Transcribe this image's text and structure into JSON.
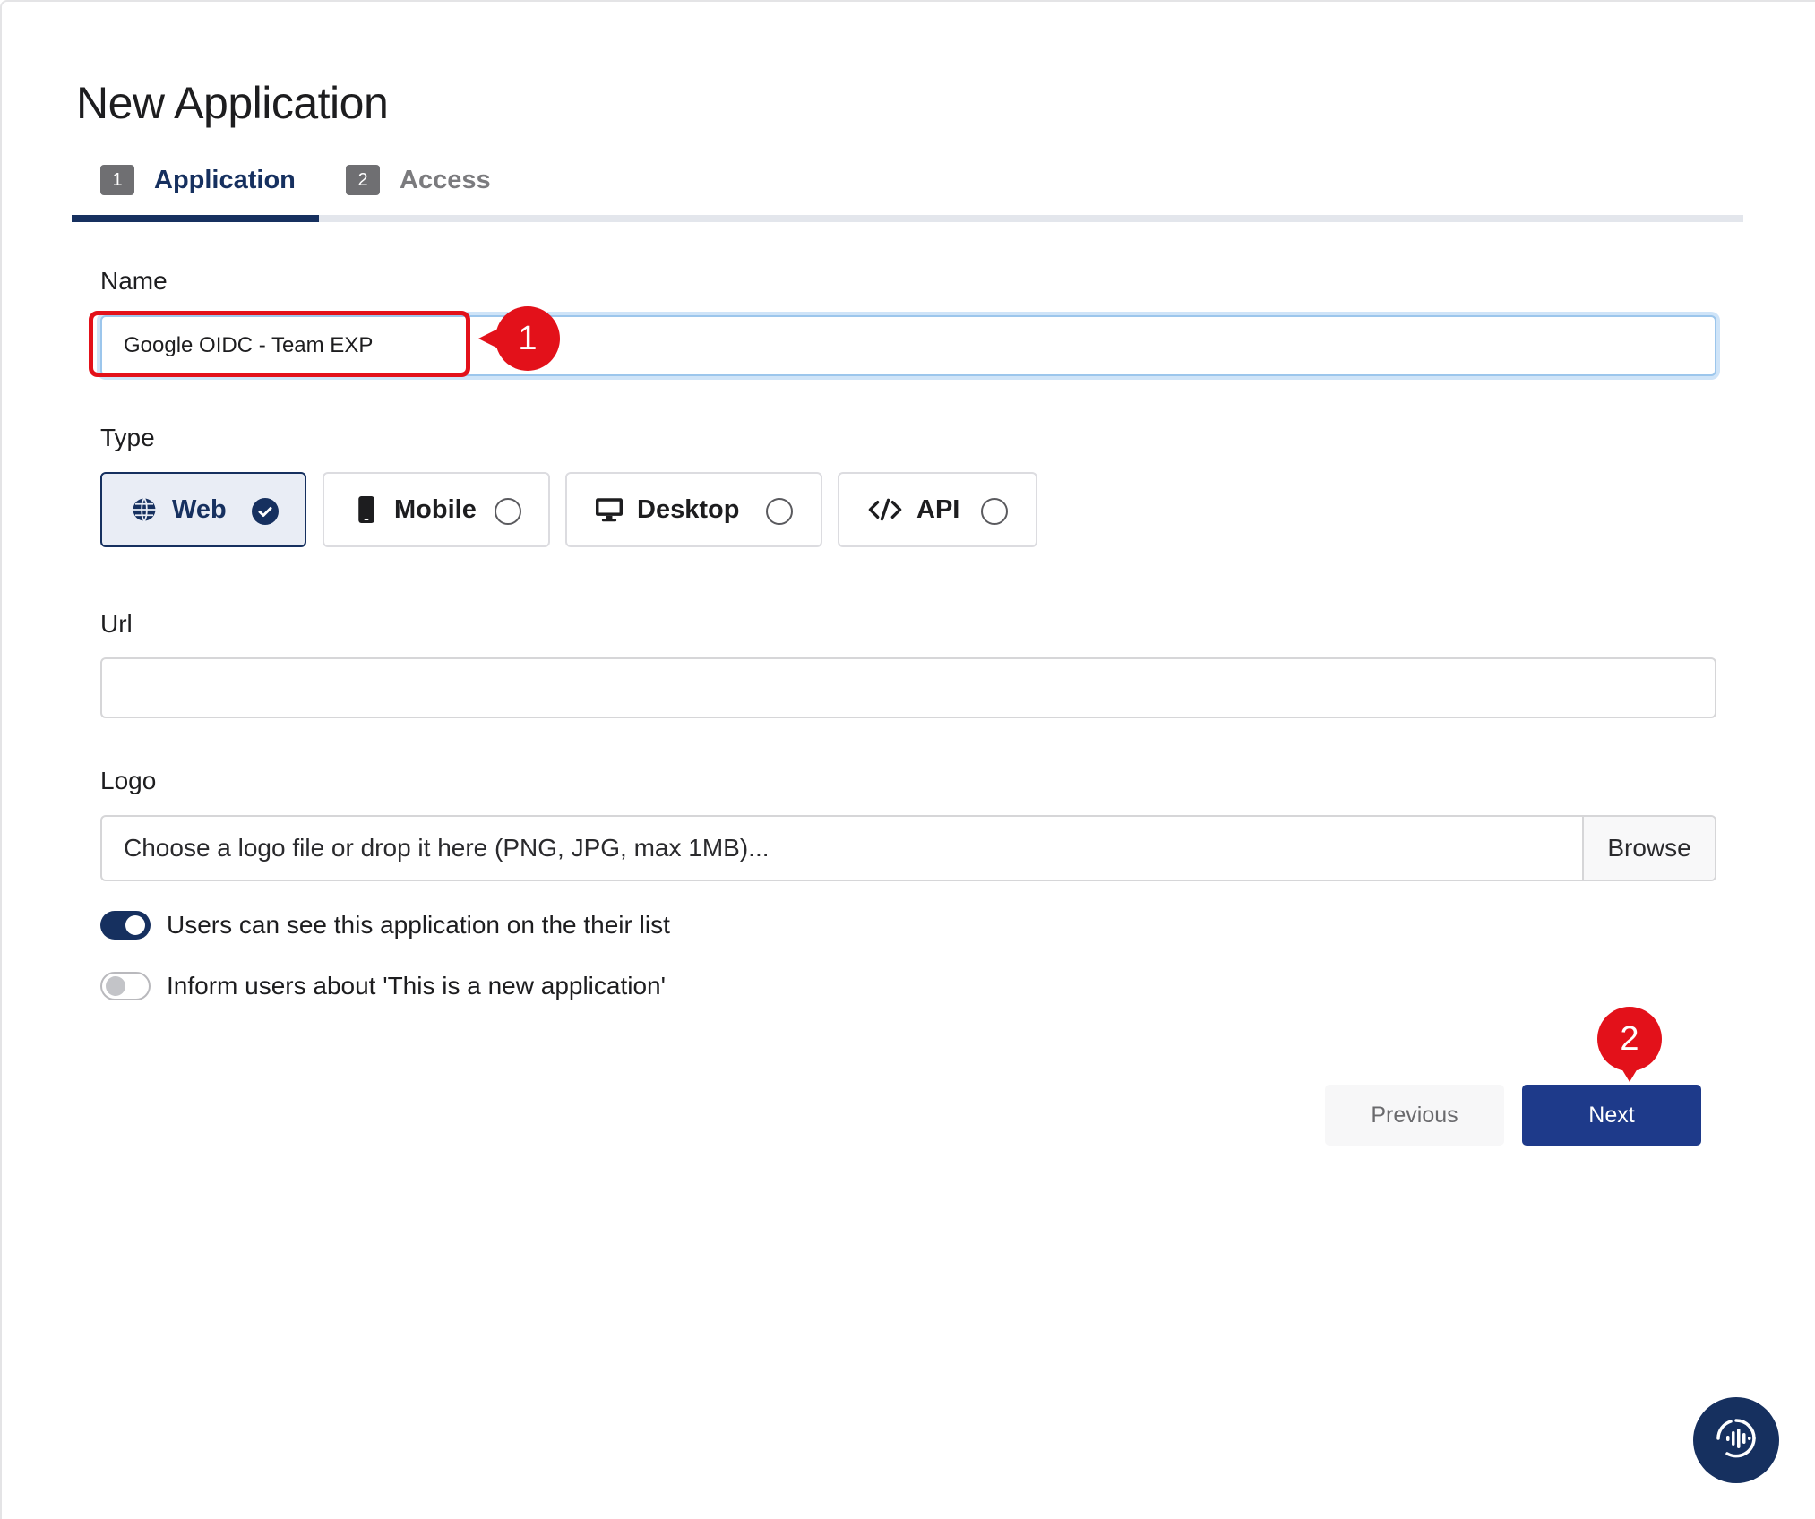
{
  "page": {
    "title": "New Application"
  },
  "tabs": [
    {
      "number": "1",
      "label": "Application",
      "active": true
    },
    {
      "number": "2",
      "label": "Access",
      "active": false
    }
  ],
  "form": {
    "name": {
      "label": "Name",
      "value": "Google OIDC - Team EXP"
    },
    "type": {
      "label": "Type",
      "options": [
        {
          "label": "Web",
          "icon": "globe-icon",
          "selected": true
        },
        {
          "label": "Mobile",
          "icon": "mobile-icon",
          "selected": false
        },
        {
          "label": "Desktop",
          "icon": "desktop-icon",
          "selected": false
        },
        {
          "label": "API",
          "icon": "code-icon",
          "selected": false
        }
      ]
    },
    "url": {
      "label": "Url",
      "value": ""
    },
    "logo": {
      "label": "Logo",
      "placeholder": "Choose a logo file or drop it here (PNG, JPG, max 1MB)...",
      "browse_label": "Browse"
    },
    "toggles": [
      {
        "label": "Users can see this application on the their list",
        "on": true
      },
      {
        "label": "Inform users about 'This is a new application'",
        "on": false
      }
    ]
  },
  "actions": {
    "previous_label": "Previous",
    "next_label": "Next"
  },
  "annotations": {
    "step1": "1",
    "step2": "2"
  },
  "colors": {
    "primary": "#16305f",
    "button": "#1e3a8a",
    "annotation": "#e3111a"
  }
}
